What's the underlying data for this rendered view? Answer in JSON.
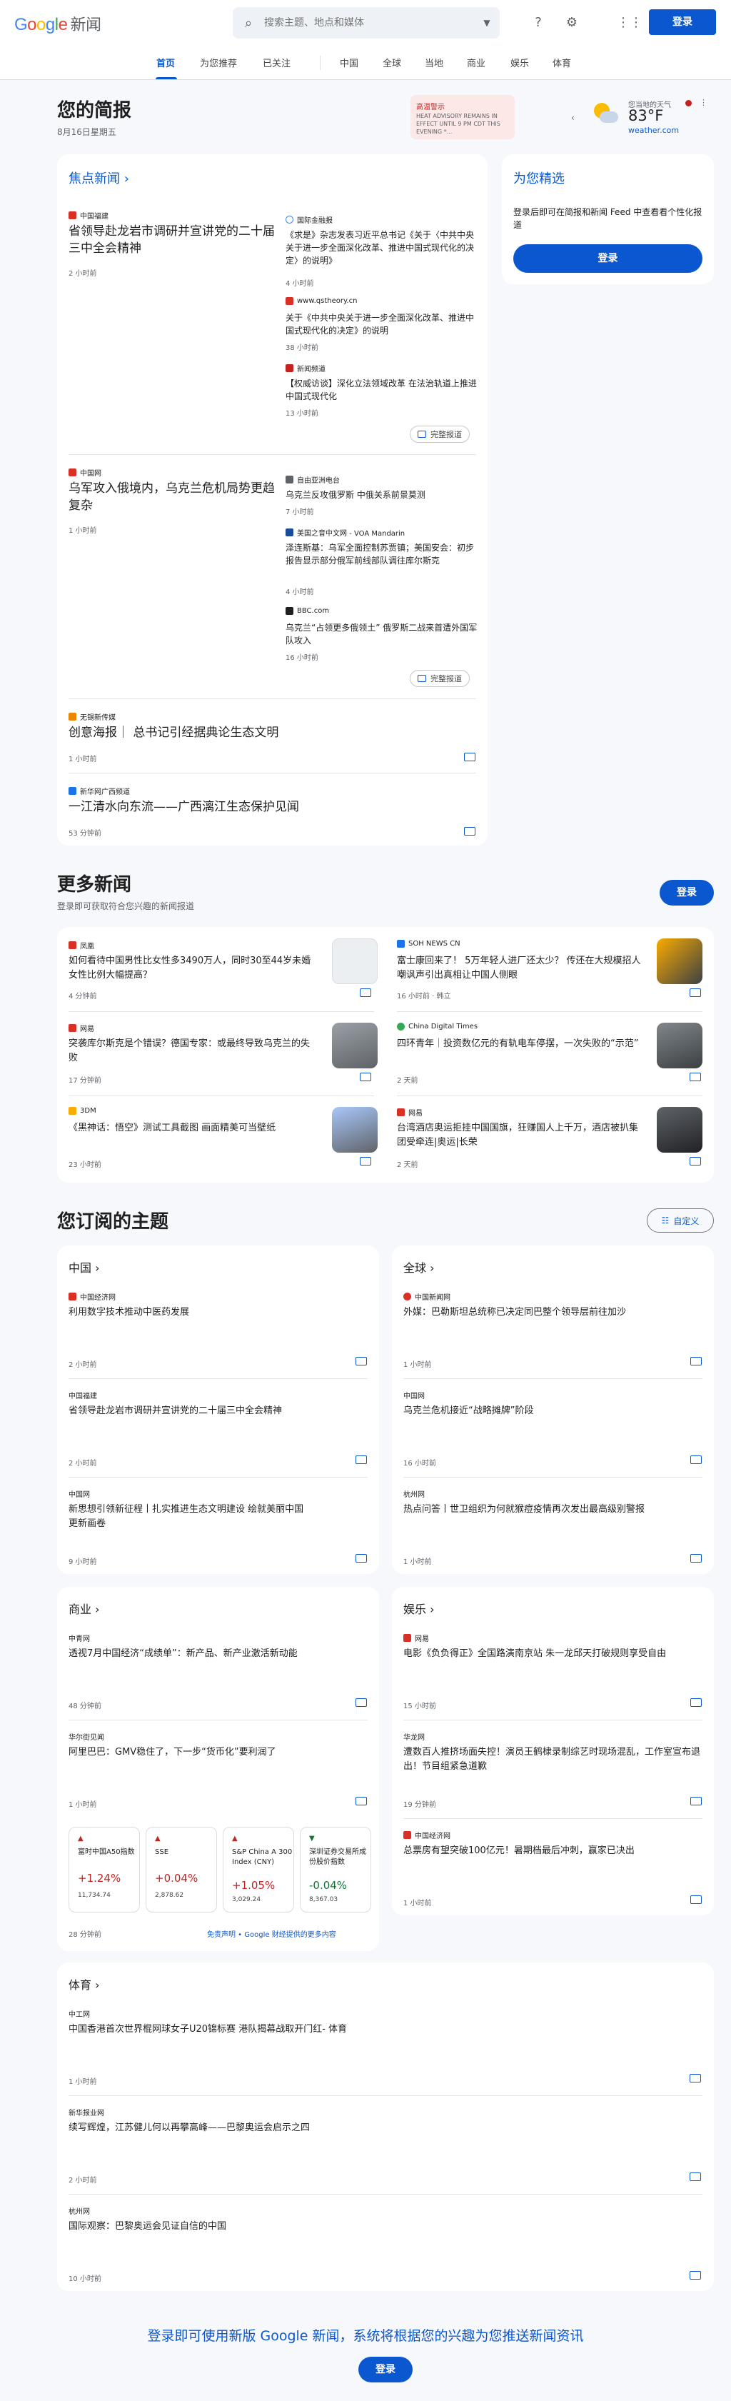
{
  "header": {
    "logo_news": "新闻",
    "search_placeholder": "搜索主题、地点和媒体",
    "signin": "登录"
  },
  "nav": {
    "items": [
      "首页",
      "为您推荐",
      "已关注",
      "中国",
      "全球",
      "当地",
      "商业",
      "娱乐",
      "体育"
    ]
  },
  "briefing": {
    "title": "您的简报",
    "date": "8月16日星期五"
  },
  "alert": {
    "title": "高温警示",
    "body": "HEAT ADVISORY REMAINS IN EFFECT UNTIL 9 PM CDT THIS EVENING *..."
  },
  "weather": {
    "label": "您当地的天气",
    "temp": "83°F",
    "source": "weather.com"
  },
  "top": {
    "title": "焦点新闻",
    "coverage": "完整报道",
    "clusters": [
      {
        "main": {
          "source": "中国福建",
          "headline": "省领导赴龙岩市调研并宣讲党的二十届三中全会精神",
          "time": "2 小时前"
        },
        "side": [
          {
            "source": "国际金融报",
            "headline": "《求是》杂志发表习近平总书记《关于〈中共中央关于进一步全面深化改革、推进中国式现代化的决定〉的说明》",
            "time": "4 小时前"
          },
          {
            "source": "www.qstheory.cn",
            "headline": "关于《中共中央关于进一步全面深化改革、推进中国式现代化的决定》的说明",
            "time": "38 小时前"
          },
          {
            "source": "新闻频道",
            "headline": "【权威访谈】深化立法领域改革 在法治轨道上推进中国式现代化",
            "time": "13 小时前"
          }
        ]
      },
      {
        "main": {
          "source": "中国网",
          "headline": "乌军攻入俄境内，乌克兰危机局势更趋复杂",
          "time": "1 小时前"
        },
        "side": [
          {
            "source": "自由亚洲电台",
            "headline": "乌克兰反攻俄罗斯 中俄关系前景莫测",
            "time": "7 小时前"
          },
          {
            "source": "美国之音中文网 - VOA Mandarin",
            "headline": "泽连斯基：乌军全面控制苏贾镇；美国安会：初步报告显示部分俄军前线部队调往库尔斯克",
            "time": "4 小时前"
          },
          {
            "source": "BBC.com",
            "headline": "乌克兰“占领更多俄领土” 俄罗斯二战来首遭外国军队攻入",
            "time": "16 小时前"
          }
        ]
      },
      {
        "main": {
          "source": "无锡新传媒",
          "headline": "创意海报｜ 总书记引经据典论生态文明",
          "time": "1 小时前"
        }
      },
      {
        "main": {
          "source": "新华网广西频道",
          "headline": "一江清水向东流——广西漓江生态保护见闻",
          "time": "53 分钟前"
        }
      }
    ]
  },
  "picks": {
    "title": "为您精选",
    "body": "登录后即可在简报和新闻 Feed 中查看看个性化报道",
    "button": "登录"
  },
  "more": {
    "title": "更多新闻",
    "subtitle": "登录即可获取符合您兴趣的新闻报道",
    "button": "登录",
    "items": [
      {
        "source": "凤凰",
        "headline": "如何看待中国男性比女性多3490万人，同时30至44岁未婚女性比例大幅提高？",
        "time": "4 分钟前"
      },
      {
        "source": "SOH NEWS CN",
        "headline": "富士康回来了！ 5万年轻人进厂还太少？ 传还在大规模招人 嘲讽声引出真相让中国人侧眼",
        "time": "16 小时前 · 韩立"
      },
      {
        "source": "网易",
        "headline": "突袭库尔斯克是个错误？德国专家：或最终导致乌克兰的失败",
        "time": "17 分钟前"
      },
      {
        "source": "China Digital Times",
        "headline": "四环青年｜投资数亿元的有轨电车停摆，一次失败的“示范”",
        "time": "2 天前"
      },
      {
        "source": "3DM",
        "headline": "《黑神话：悟空》测试工具截图 画面精美可当壁纸",
        "time": "23 小时前"
      },
      {
        "source": "网易",
        "headline": "台湾酒店奥运拒挂中国国旗，狂赚国人上千万，酒店被扒集团受牵连|奥运|长荣",
        "time": "2 天前"
      }
    ]
  },
  "topics": {
    "title": "您订阅的主题",
    "customize": "自定义",
    "china": {
      "title": "中国",
      "items": [
        {
          "source": "中国经济网",
          "headline": "利用数字技术推动中医药发展",
          "time": "2 小时前"
        },
        {
          "source": "中国福建",
          "headline": "省领导赴龙岩市调研并宣讲党的二十届三中全会精神",
          "time": "2 小时前"
        },
        {
          "source": "中国网",
          "headline": "新思想引领新征程丨扎实推进生态文明建设 绘就美丽中国更新画卷",
          "time": "9 小时前"
        }
      ]
    },
    "world": {
      "title": "全球",
      "items": [
        {
          "source": "中国新闻网",
          "headline": "外媒：巴勒斯坦总统称已决定同巴整个领导层前往加沙",
          "time": "1 小时前"
        },
        {
          "source": "中国网",
          "headline": "乌克兰危机接近“战略摊牌”阶段",
          "time": "16 小时前"
        },
        {
          "source": "杭州网",
          "headline": "热点问答丨世卫组织为何就猴痘疫情再次发出最高级别警报",
          "time": "1 小时前"
        }
      ]
    },
    "business": {
      "title": "商业",
      "items": [
        {
          "source": "中青网",
          "headline": "透视7月中国经济“成绩单”：新产品、新产业激活新动能",
          "time": "48 分钟前"
        },
        {
          "source": "华尔街见闻",
          "headline": "阿里巴巴：GMV稳住了，下一步“货币化”要利润了",
          "time": "1 小时前"
        }
      ],
      "stocks": [
        {
          "name": "富时中国A50指数",
          "change": "+1.24%",
          "value": "11,734.74"
        },
        {
          "name": "SSE",
          "change": "+0.04%",
          "value": "2,878.62"
        },
        {
          "name": "S&P China A 300 Index (CNY)",
          "change": "+1.05%",
          "value": "3,029.24"
        },
        {
          "name": "深圳证券交易所成份股价指数",
          "change": "-0.04%",
          "value": "8,367.03"
        }
      ],
      "stock_time": "28 分钟前",
      "disclaimer": "免责声明 • Google 财经提供的更多内容"
    },
    "ent": {
      "title": "娱乐",
      "items": [
        {
          "source": "网易",
          "headline": "电影《负负得正》全国路演南京站 朱一龙邱天打破规则享受自由",
          "time": "15 小时前"
        },
        {
          "source": "华龙网",
          "headline": "遭数百人推挤场面失控！演员王鹤棣录制综艺时现场混乱，工作室宣布退出！节目组紧急道歉",
          "time": "19 分钟前"
        },
        {
          "source": "中国经济网",
          "headline": "总票房有望突破100亿元！暑期档最后冲刺，赢家已决出",
          "time": "1 小时前"
        }
      ]
    },
    "sports": {
      "title": "体育",
      "items": [
        {
          "source": "中工网",
          "headline": "中国香港首次世界棍网球女子U20锦标赛 港队揭幕战取开门红- 体育",
          "time": "1 小时前"
        },
        {
          "source": "新华报业网",
          "headline": "续写辉煌，江苏健儿何以再攀高峰——巴黎奥运会启示之四",
          "time": "2 小时前"
        },
        {
          "source": "杭州网",
          "headline": "国际观察：巴黎奥运会见证自信的中国",
          "time": "10 小时前"
        }
      ]
    }
  },
  "footer": {
    "text": "登录即可使用新版 Google 新闻，系统将根据您的兴趣为您推送新闻资讯",
    "button": "登录"
  },
  "colors": {
    "accent": "#0b57d0",
    "up": "#c5221f",
    "down": "#137333"
  }
}
